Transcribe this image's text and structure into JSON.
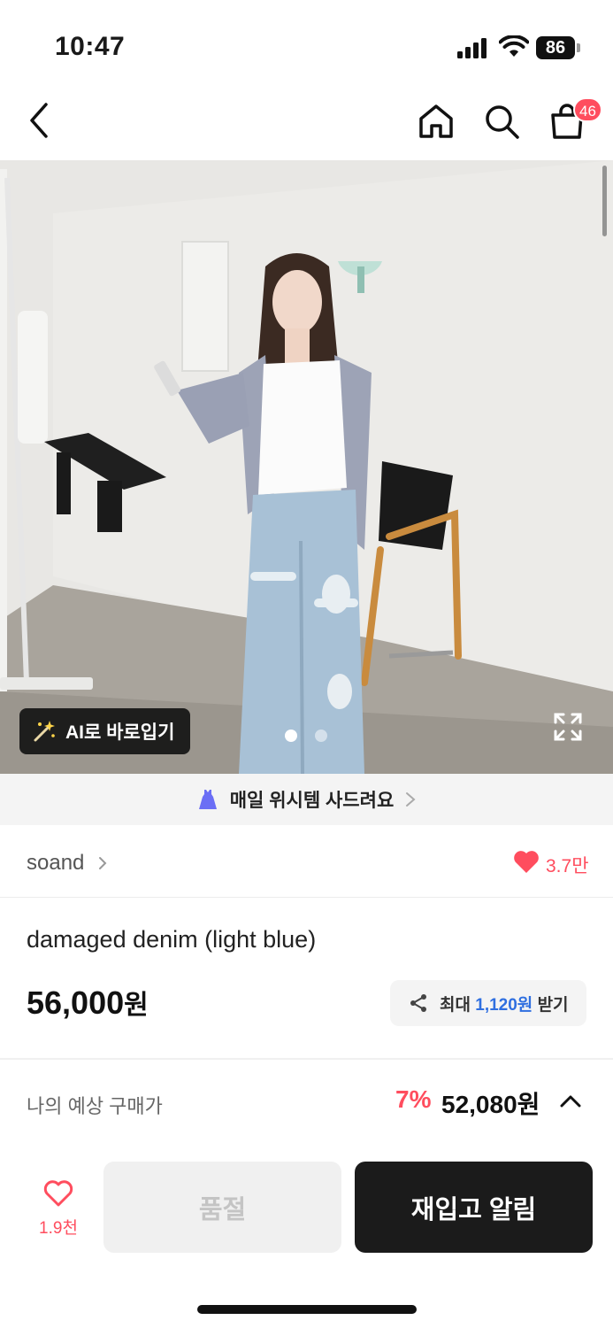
{
  "status_bar": {
    "time": "10:47",
    "battery": "86",
    "icons": [
      "signal-icon",
      "wifi-icon",
      "battery-icon"
    ]
  },
  "header": {
    "icons": [
      "back-icon",
      "home-icon",
      "search-icon",
      "bag-icon"
    ],
    "cart_count": "46"
  },
  "hero": {
    "ai_button_label": "AI로 바로입기",
    "page_count": 2,
    "active_page": 1
  },
  "promo": {
    "text": "매일 위시템 사드려요"
  },
  "brand": {
    "name": "soand",
    "likes": "3.7만"
  },
  "product": {
    "name": "damaged denim (light blue)",
    "price": "56,000",
    "currency": "원",
    "reward_prefix": "최대",
    "reward_amount": "1,120원",
    "reward_suffix": "받기"
  },
  "expected_price": {
    "label": "나의 예상 구매가",
    "discount": "7%",
    "price": "52,080원"
  },
  "actions": {
    "wish_count": "1.9천",
    "soldout_label": "품절",
    "restock_label": "재입고 알림"
  },
  "colors": {
    "accent_red": "#ff4d5e",
    "accent_blue": "#2f6fe0",
    "dark": "#1b1b1b"
  }
}
